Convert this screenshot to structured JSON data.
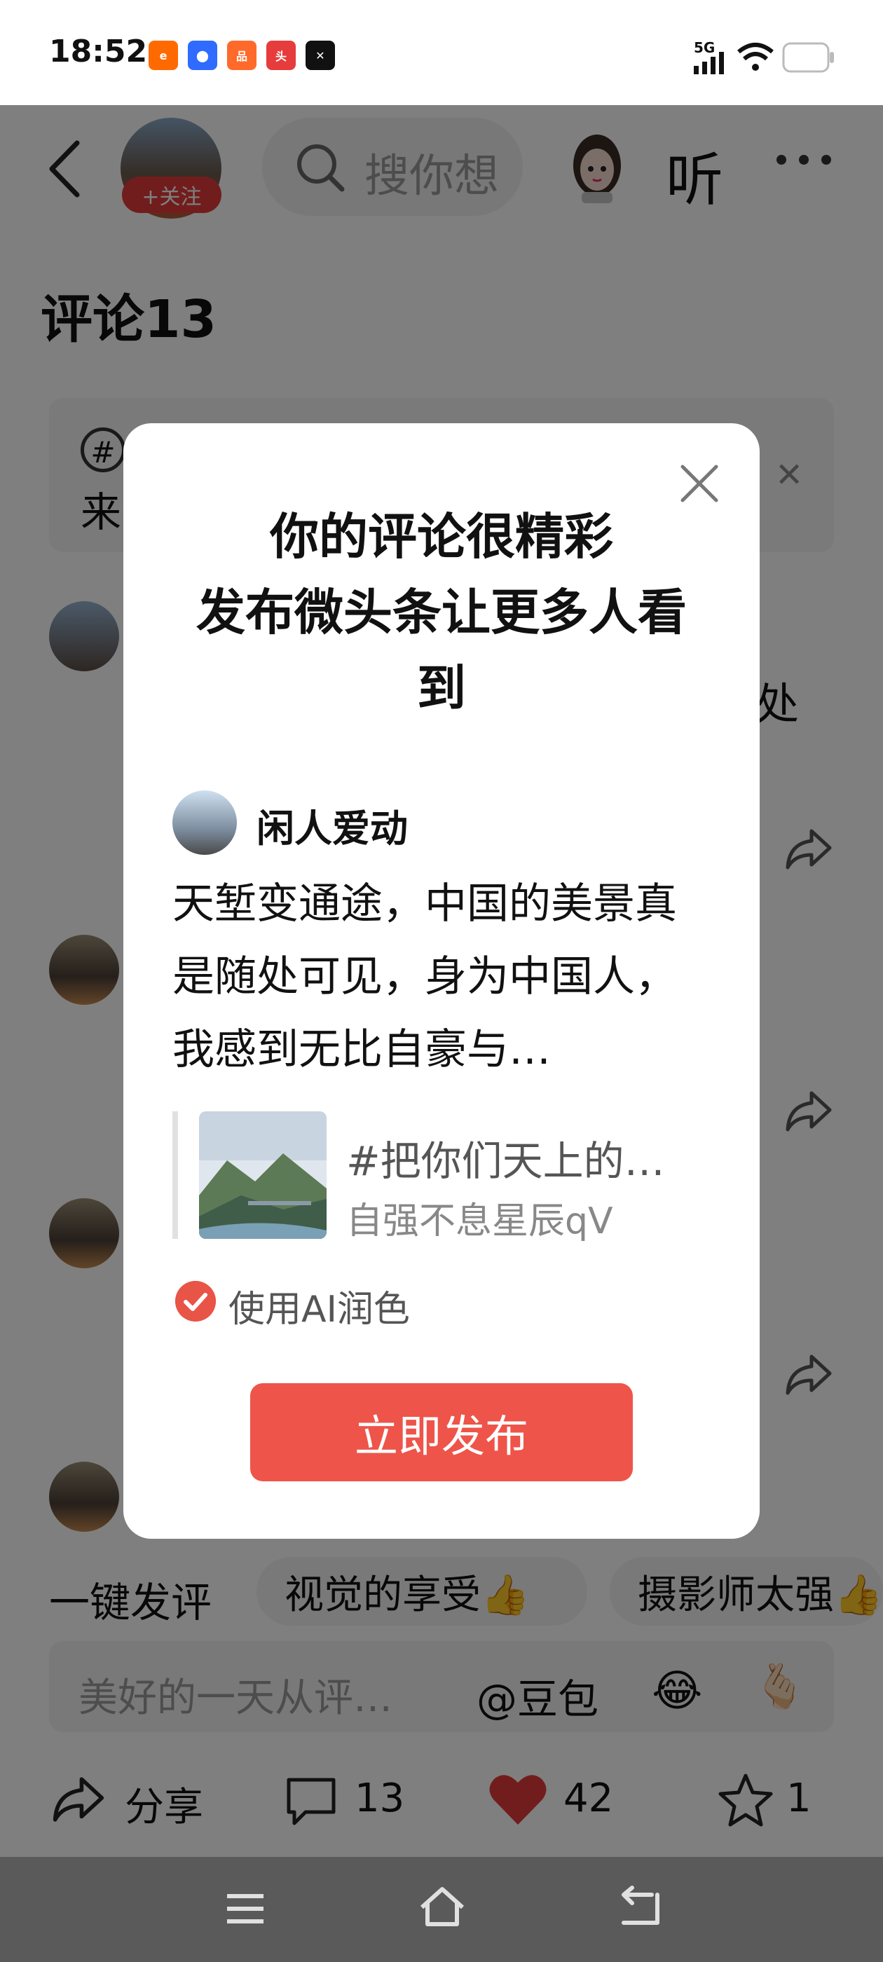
{
  "status_bar": {
    "time": "18:52",
    "net": "5G"
  },
  "header": {
    "follow_label": "+关注",
    "search_placeholder": "搜你想",
    "listen_label": "听"
  },
  "comments": {
    "title": "评论13",
    "hint_prefix": "来",
    "stray_text": "处"
  },
  "quick_comments": {
    "label": "一键发评",
    "chips": [
      "视觉的享受👍",
      "摄影师太强👍"
    ]
  },
  "input": {
    "placeholder": "美好的一天从评…",
    "at_label": "@豆包",
    "emoji1": "😂",
    "emoji2": "🫰🏻"
  },
  "bottom_actions": {
    "share_label": "分享",
    "comment_count": "13",
    "like_count": "42",
    "fav_count": "1"
  },
  "modal": {
    "title_line1": "你的评论很精彩",
    "title_line2": "发布微头条让更多人看",
    "title_line3": "到",
    "username": "闲人爱动",
    "body": "天堑变通途，中国的美景真是随处可见，身为中国人，我感到无比自豪与…",
    "quote_title": "#把你们天上的…",
    "quote_author": "自强不息星辰qV",
    "ai_label": "使用AI润色",
    "publish_label": "立即发布"
  },
  "colors": {
    "accent": "#EE5449",
    "like": "#E53B3B",
    "overlay": "rgba(0,0,0,0.5)"
  }
}
